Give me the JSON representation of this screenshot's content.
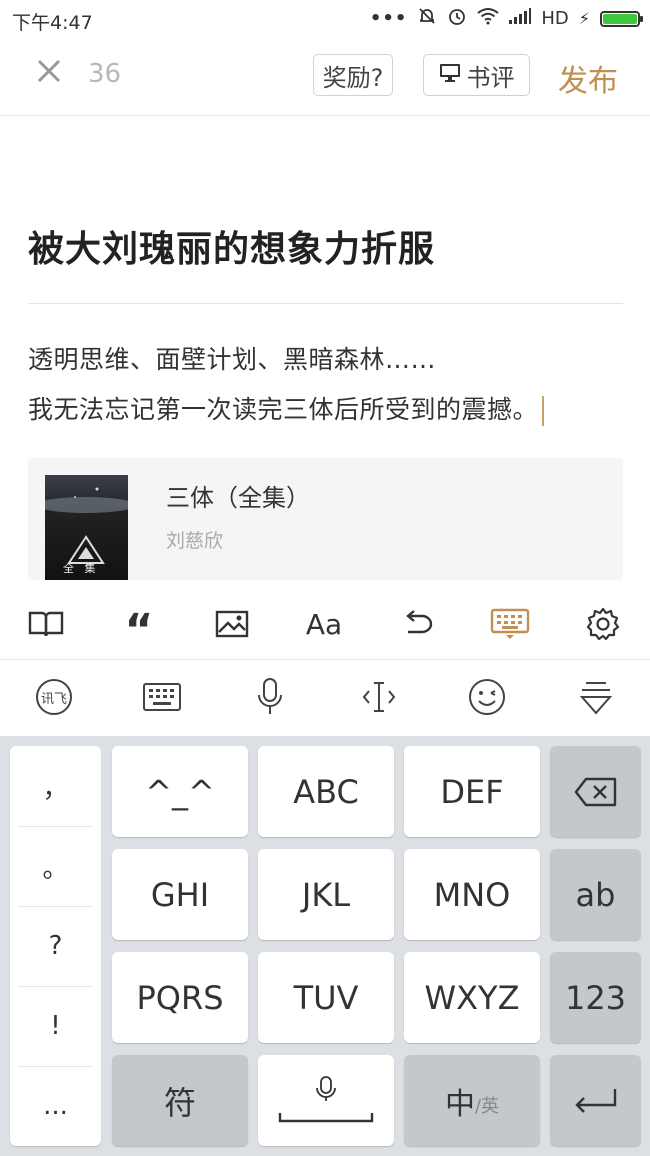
{
  "status_bar": {
    "time": "下午4:47",
    "network": "HD"
  },
  "top_bar": {
    "char_count": "36",
    "reward_label": "奖励?",
    "review_label": "书评",
    "publish_label": "发布"
  },
  "article": {
    "title": "被大刘瑰丽的想象力折服",
    "lines": [
      "透明思维、面壁计划、黑暗森林……",
      "我无法忘记第一次读完三体后所受到的震撼。"
    ]
  },
  "book_card": {
    "title": "三体（全集）",
    "author": "刘慈欣",
    "cover_text_bottom": "全   集"
  },
  "editor_toolbar": {
    "font_label": "Aa"
  },
  "ime_toolbar": {
    "logo_text": "讯飞"
  },
  "keyboard": {
    "punctuation": [
      "，",
      "。",
      "?",
      "!",
      "..."
    ],
    "rows": [
      [
        "^_^",
        "ABC",
        "DEF"
      ],
      [
        "GHI",
        "JKL",
        "MNO"
      ],
      [
        "PQRS",
        "TUV",
        "WXYZ"
      ]
    ],
    "side_keys": [
      "ab",
      "123"
    ],
    "symbol_key": "符",
    "lang_key_main": "中",
    "lang_key_sub": "/英"
  },
  "colors": {
    "accent": "#c08f52",
    "keyboard_bg": "#dcdfe3",
    "gray_key": "#c4c8cd"
  }
}
